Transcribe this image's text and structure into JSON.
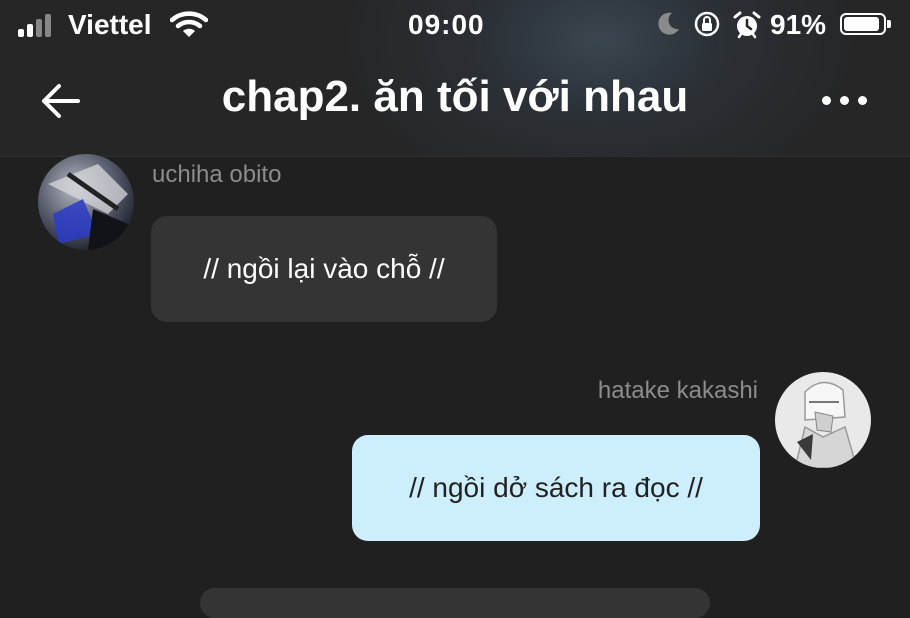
{
  "status_bar": {
    "carrier": "Viettel",
    "time": "09:00",
    "battery_percent": "91%",
    "battery_level": 0.91,
    "icons": [
      "signal-icon",
      "wifi-icon",
      "moon-icon",
      "rotation-lock-icon",
      "alarm-icon",
      "battery-icon"
    ]
  },
  "header": {
    "title": "chap2. ăn tối với nhau",
    "back_icon": "arrow-left-icon",
    "more_icon": "more-dots-icon"
  },
  "messages": [
    {
      "sender": "uchiha obito",
      "text": "// ngồi lại vào chỗ //",
      "side": "left"
    },
    {
      "sender": "hatake kakashi",
      "text": "// ngồi dở sách ra đọc //",
      "side": "right"
    }
  ],
  "colors": {
    "background": "#202020",
    "incoming_bubble": "#343434",
    "outgoing_bubble": "#cdeefd",
    "sender_name": "#8c8c8c"
  }
}
